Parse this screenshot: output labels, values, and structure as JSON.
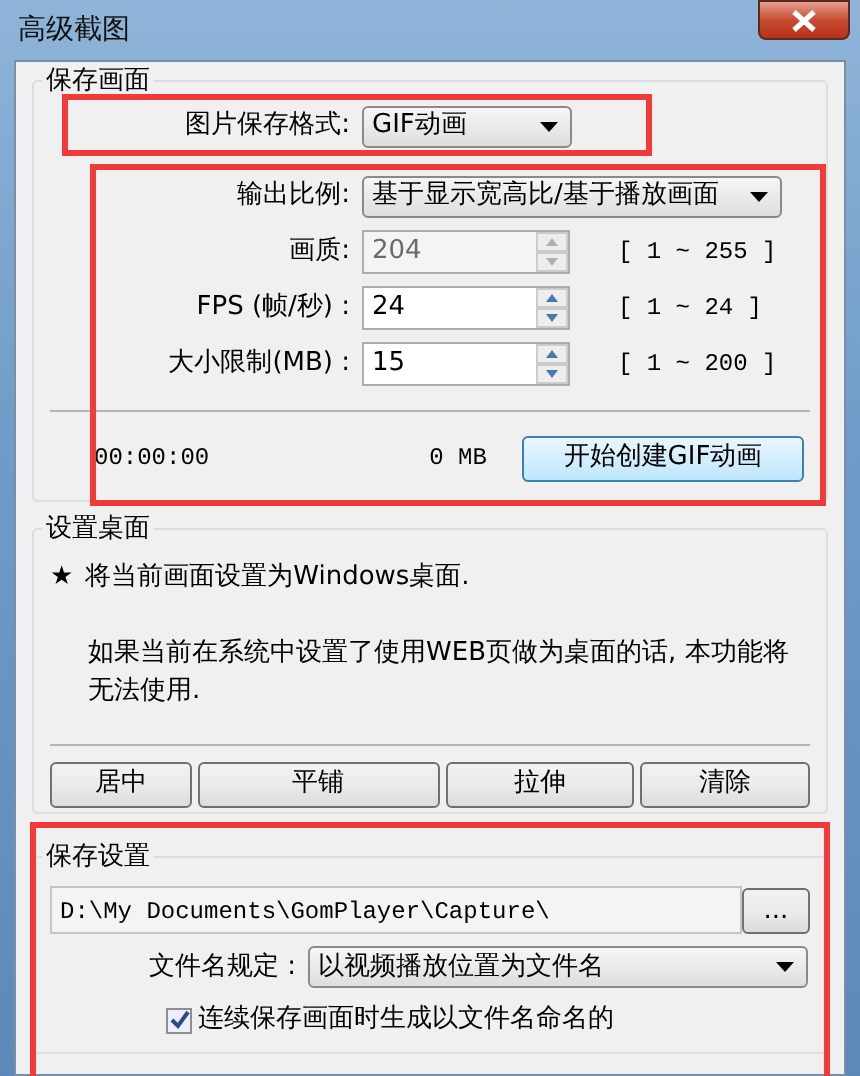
{
  "window": {
    "title": "高级截图"
  },
  "save_frame": {
    "title": "保存画面",
    "format": {
      "label": "图片保存格式:",
      "value": "GIF动画"
    },
    "output_ratio": {
      "label": "输出比例:",
      "value": "基于显示宽高比/基于播放画面"
    },
    "fields": [
      {
        "label": "画质:",
        "value": "204",
        "range": "[ 1 ~ 255 ]",
        "disabled": true
      },
      {
        "label": "FPS (帧/秒) :",
        "value": "24",
        "range": "[ 1 ~ 24 ]",
        "disabled": false
      },
      {
        "label": "大小限制(MB) :",
        "value": "15",
        "range": "[ 1 ~ 200 ]",
        "disabled": false
      }
    ],
    "elapsed": "00:00:00",
    "size": "0 MB",
    "start_button": "开始创建GIF动画"
  },
  "desktop": {
    "title": "设置桌面",
    "bullet": "★",
    "line_1": "将当前画面设置为Windows桌面.",
    "line_2": "如果当前在系统中设置了使用WEB页做为桌面的话, 本功能将无法使用.",
    "buttons": [
      "居中",
      "平铺",
      "拉伸",
      "清除"
    ]
  },
  "save_settings": {
    "title": "保存设置",
    "path": "D:\\My Documents\\GomPlayer\\Capture\\",
    "browse_button": "...",
    "filename_rule": {
      "label": "文件名规定 :",
      "value": "以视频播放位置为文件名"
    },
    "checkbox": {
      "label": "连续保存画面时生成以文件名命名的",
      "checked": true
    }
  }
}
